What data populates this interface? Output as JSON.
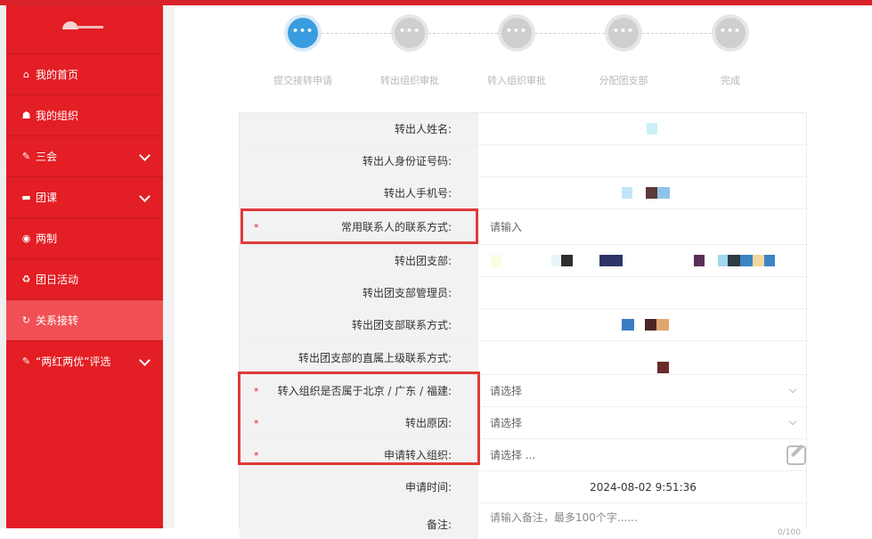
{
  "sidebar": {
    "items": [
      {
        "label": "我的首页",
        "icon": "home-icon",
        "glyph": "⌂",
        "chevron": false,
        "active": false
      },
      {
        "label": "我的组织",
        "icon": "users-icon",
        "glyph": "☗",
        "chevron": false,
        "active": false
      },
      {
        "label": "三会",
        "icon": "edit-icon",
        "glyph": "✎",
        "chevron": true,
        "active": false
      },
      {
        "label": "团课",
        "icon": "folder-icon",
        "glyph": "▬",
        "chevron": true,
        "active": false
      },
      {
        "label": "两制",
        "icon": "target-icon",
        "glyph": "◉",
        "chevron": false,
        "active": false
      },
      {
        "label": "团日活动",
        "icon": "recycle-icon",
        "glyph": "♻",
        "chevron": false,
        "active": false
      },
      {
        "label": "关系接转",
        "icon": "refresh-icon",
        "glyph": "↻",
        "chevron": false,
        "active": true
      },
      {
        "label": "“两红两优”评选",
        "icon": "edit-icon",
        "glyph": "✎",
        "chevron": true,
        "active": false
      }
    ]
  },
  "stepper": {
    "steps": [
      {
        "label": "提交接转申请",
        "dots": "•••",
        "active": true
      },
      {
        "label": "转出组织审批",
        "dots": "•••",
        "active": false
      },
      {
        "label": "转入组织审批",
        "dots": "•••",
        "active": false
      },
      {
        "label": "分配团支部",
        "dots": "•••",
        "active": false
      },
      {
        "label": "完成",
        "dots": "•••",
        "active": false
      }
    ]
  },
  "form": {
    "transfer_out_name_label": "转出人姓名:",
    "id_number_label": "转出人身份证号码:",
    "phone_label": "转出人手机号:",
    "contact_label": "常用联系人的联系方式:",
    "contact_placeholder": "请输入",
    "branch_label": "转出团支部:",
    "branch_admin_label": "转出团支部管理员:",
    "branch_contact_label": "转出团支部联系方式:",
    "superior_contact_label": "转出团支部的直属上级联系方式:",
    "region_label": "转入组织是否属于北京 / 广东 / 福建:",
    "region_placeholder": "请选择",
    "reason_label": "转出原因:",
    "reason_placeholder": "请选择",
    "target_org_label": "申请转入组织:",
    "target_org_placeholder": "请选择 ...",
    "apply_time_label": "申请时间:",
    "apply_time_value": "2024-08-02 9:51:36",
    "remark_label": "备注:",
    "remark_placeholder": "请输入备注，最多100个字......",
    "remark_counter": "0/100",
    "required_mark": "*"
  },
  "colors": {
    "sidebar": "#e31e24",
    "sidebar_active": "#f05055",
    "step_active": "#3a9ce0",
    "highlight_border": "#e03a3a"
  }
}
